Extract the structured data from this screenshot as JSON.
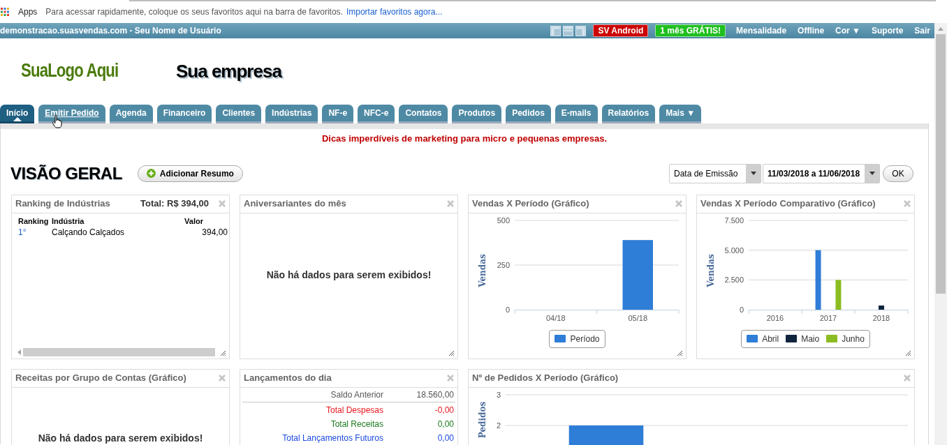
{
  "bookmarks_bar": {
    "apps_label": "Apps",
    "hint": "Para acessar rapidamente, coloque os seus favoritos aqui na barra de favoritos.",
    "import_link": "Importar favoritos agora..."
  },
  "top_bar": {
    "site": "demonstracao.suasvendas.com - Seu Nome de Usuário",
    "badges": [
      {
        "label": "SV Android",
        "color": "#cc0000"
      },
      {
        "label": "1 mês GRÁTIS!",
        "color": "#1fbf1f"
      }
    ],
    "links": [
      {
        "label": "Mensalidade"
      },
      {
        "label": "Offline"
      },
      {
        "label": "Cor",
        "caret": "▼"
      },
      {
        "label": "Suporte"
      },
      {
        "label": "Sair"
      }
    ]
  },
  "header": {
    "logo": "SuaLogo Aqui",
    "company": "Sua empresa"
  },
  "tabs": [
    {
      "label": "Início",
      "selected": true,
      "hovered": false
    },
    {
      "label": "Emitir Pedido",
      "selected": false,
      "hovered": true
    },
    {
      "label": "Agenda",
      "selected": false,
      "hovered": false
    },
    {
      "label": "Financeiro",
      "selected": false,
      "hovered": false
    },
    {
      "label": "Clientes",
      "selected": false,
      "hovered": false
    },
    {
      "label": "Indústrias",
      "selected": false,
      "hovered": false
    },
    {
      "label": "NF-e",
      "selected": false,
      "hovered": false
    },
    {
      "label": "NFC-e",
      "selected": false,
      "hovered": false
    },
    {
      "label": "Contatos",
      "selected": false,
      "hovered": false
    },
    {
      "label": "Produtos",
      "selected": false,
      "hovered": false
    },
    {
      "label": "Pedidos",
      "selected": false,
      "hovered": false
    },
    {
      "label": "E-mails",
      "selected": false,
      "hovered": false
    },
    {
      "label": "Relatórios",
      "selected": false,
      "hovered": false
    },
    {
      "label": "Mais",
      "caret": "▼",
      "selected": false,
      "hovered": false
    }
  ],
  "tip": "Dicas imperdíveis de marketing para micro e pequenas empresas.",
  "page_title": "VISÃO GERAL",
  "add_button": "Adicionar Resumo",
  "filters": {
    "date_type": "Data de Emissão",
    "date_range": "11/03/2018 a 11/06/2018",
    "ok": "OK"
  },
  "widgets": [
    {
      "kind": "ranking",
      "title": "Ranking de Indústrias",
      "total": "Total: R$ 394,00",
      "columns": [
        "Ranking",
        "Indústria",
        "Valor"
      ],
      "rows": [
        [
          "1°",
          "Calçando Calçados",
          "394,00"
        ]
      ]
    },
    {
      "kind": "empty",
      "title": "Aniversariantes do mês",
      "message": "Não há dados para serem exibidos!"
    },
    {
      "kind": "chart",
      "title": "Vendas X Período (Gráfico)",
      "chart_data": {
        "type": "bar",
        "ylabel": "Vendas",
        "categories": [
          "04/18",
          "05/18"
        ],
        "series": [
          {
            "name": "Período",
            "color": "#2e7dd7",
            "values": [
              null,
              390
            ]
          }
        ],
        "ylim": [
          0,
          500
        ],
        "yticks": [
          0,
          250,
          500
        ]
      }
    },
    {
      "kind": "chart",
      "title": "Vendas X Período Comparativo (Gráfico)",
      "chart_data": {
        "type": "bar",
        "ylabel": "Vendas",
        "categories": [
          "2016",
          "2017",
          "2018"
        ],
        "series": [
          {
            "name": "Abril",
            "color": "#2e7dd7",
            "values": [
              null,
              5000,
              null
            ]
          },
          {
            "name": "Maio",
            "color": "#10243e",
            "values": [
              null,
              null,
              350
            ]
          },
          {
            "name": "Junho",
            "color": "#8bbc21",
            "values": [
              null,
              2500,
              null
            ]
          }
        ],
        "ylim": [
          0,
          7500
        ],
        "yticks": [
          0,
          {
            "value": 2500,
            "label": "2.500"
          },
          {
            "value": 5000,
            "label": "5.000"
          },
          {
            "value": 7500,
            "label": "7.500"
          }
        ]
      }
    },
    {
      "kind": "empty",
      "title": "Receitas por Grupo de Contas (Gráfico)",
      "message": "Não há dados para serem exibidos!"
    },
    {
      "kind": "ledger",
      "title": "Lançamentos do dia",
      "rows": [
        {
          "kind": "balance",
          "label": "Saldo Anterior",
          "value": "18.560,00"
        },
        {
          "kind": "expense",
          "label": "Total Despesas",
          "value": "-0,00"
        },
        {
          "kind": "income",
          "label": "Total Receitas",
          "value": "0,00"
        },
        {
          "kind": "future",
          "label": "Total Lançamentos Futuros",
          "value": "0,00"
        }
      ]
    },
    {
      "kind": "chart",
      "title": "Nº de Pedidos X Período (Gráfico)",
      "chart_data": {
        "type": "bar",
        "ylabel": "Pedidos",
        "values": [
          2,
          null
        ],
        "ylim": [
          0,
          3
        ],
        "yticks": [
          2,
          3
        ]
      }
    }
  ]
}
